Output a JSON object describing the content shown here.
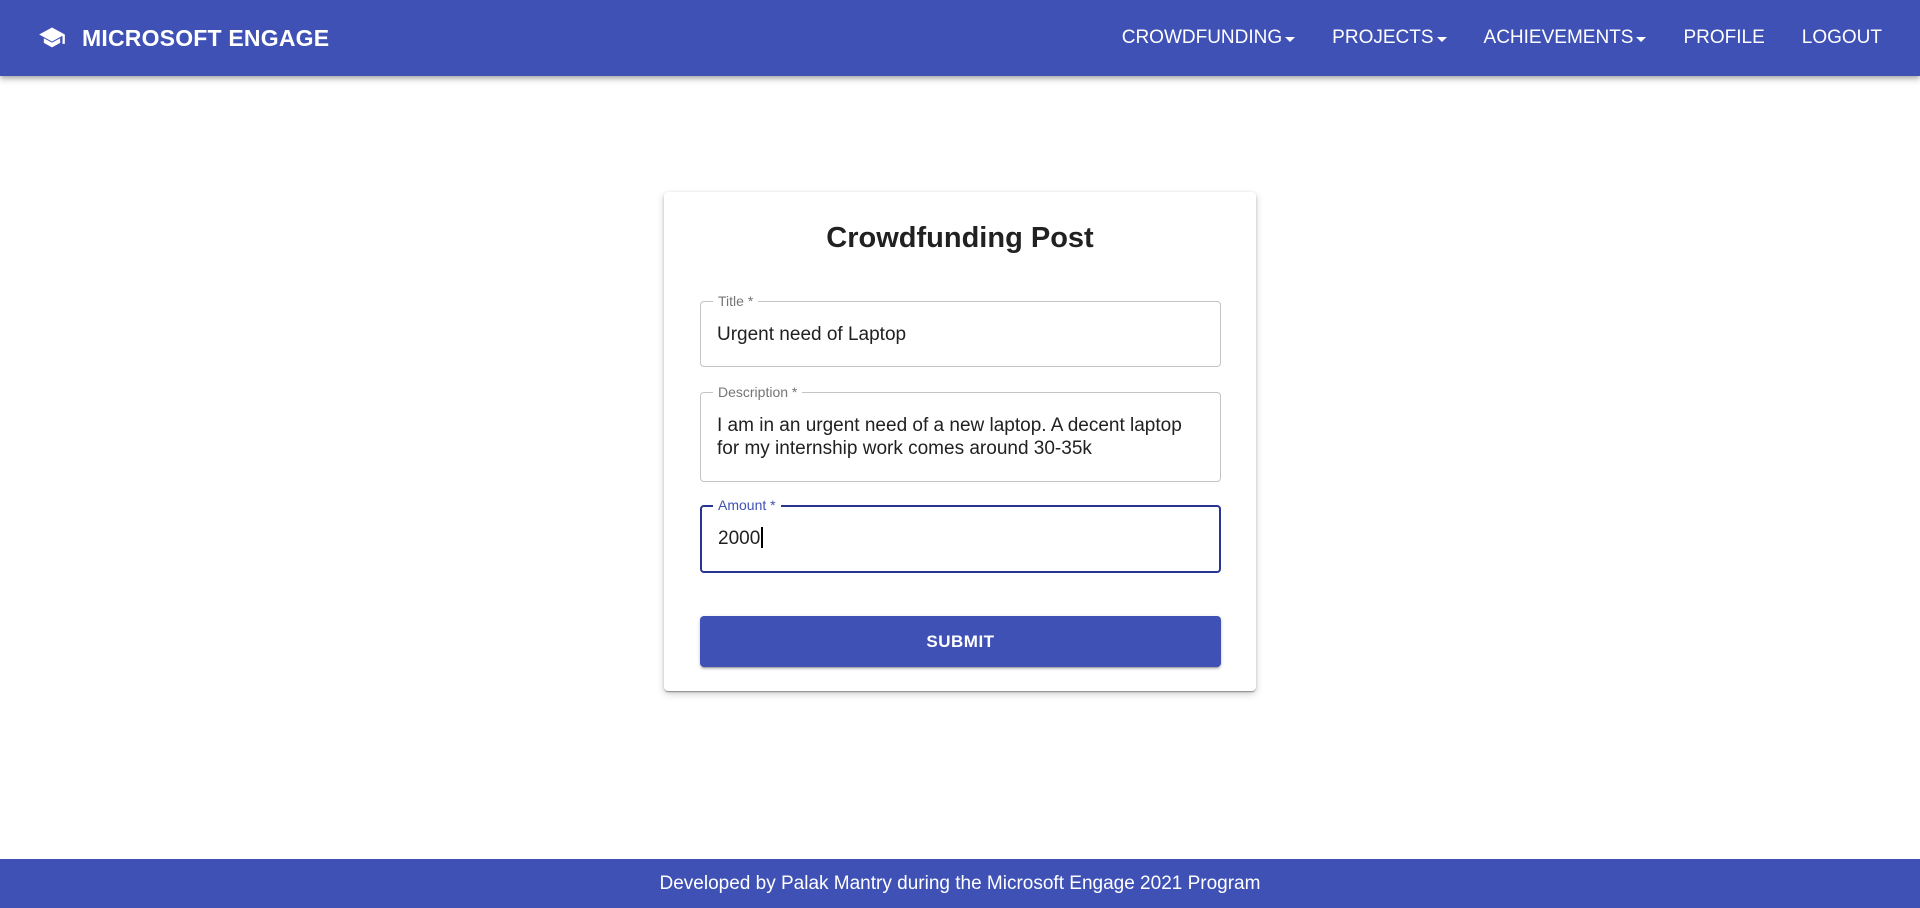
{
  "header": {
    "brand": "MICROSOFT ENGAGE",
    "brand_icon": "graduation-cap-icon",
    "nav": [
      {
        "label": "CROWDFUNDING",
        "dropdown": true
      },
      {
        "label": "PROJECTS",
        "dropdown": true
      },
      {
        "label": "ACHIEVEMENTS",
        "dropdown": true
      },
      {
        "label": "PROFILE",
        "dropdown": false
      },
      {
        "label": "LOGOUT",
        "dropdown": false
      }
    ]
  },
  "form": {
    "title": "Crowdfunding Post",
    "fields": {
      "title": {
        "label": "Title *",
        "value": "Urgent need of Laptop"
      },
      "description": {
        "label": "Description *",
        "value_line1": "I am in an urgent need of a new laptop. A decent laptop",
        "value_line2": "for my internship work comes around 30-35k"
      },
      "amount": {
        "label": "Amount *",
        "value": "2000",
        "focused": true
      }
    },
    "submit_label": "SUBMIT"
  },
  "footer": {
    "text": "Developed by Palak Mantry during the Microsoft Engage 2021 Program"
  },
  "colors": {
    "primary": "#3f51b5",
    "focus_border": "#283593",
    "text": "#212121"
  }
}
